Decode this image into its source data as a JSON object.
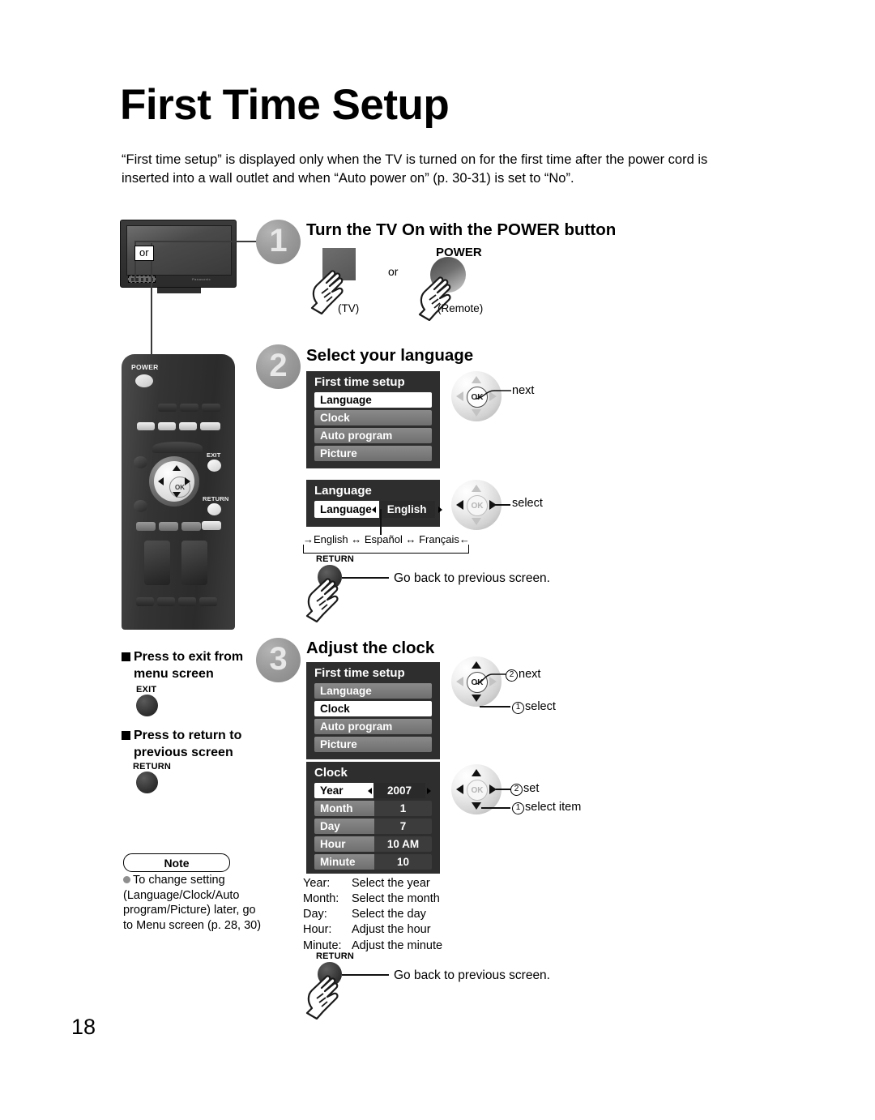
{
  "page": {
    "title": "First Time Setup",
    "intro": "“First time setup” is displayed only when the TV is turned on for the first time after the power cord is inserted into a wall outlet and when “Auto power on” (p. 30-31) is set to “No”.",
    "number": "18"
  },
  "step1": {
    "number": "1",
    "heading": "Turn the TV On with the POWER button",
    "tv_or_label": "or",
    "or_text": "or",
    "power_label": "POWER",
    "tv_caption": "(TV)",
    "remote_caption": "(Remote)"
  },
  "step2": {
    "number": "2",
    "heading": "Select your language",
    "menu": {
      "title": "First time setup",
      "items": [
        {
          "label": "Language",
          "selected": true
        },
        {
          "label": "Clock",
          "selected": false
        },
        {
          "label": "Auto program",
          "selected": false
        },
        {
          "label": "Picture",
          "selected": false
        }
      ]
    },
    "nav_next_label": "next",
    "language_menu": {
      "title": "Language",
      "row_label": "Language",
      "row_value": "English"
    },
    "nav_select_label": "select",
    "language_cycle": "→English ↔ Español ↔ Français←",
    "return_button_label": "RETURN",
    "return_text": "Go back to previous screen."
  },
  "step3": {
    "number": "3",
    "heading": "Adjust the clock",
    "menu": {
      "title": "First time setup",
      "items": [
        {
          "label": "Language",
          "selected": false
        },
        {
          "label": "Clock",
          "selected": true
        },
        {
          "label": "Auto program",
          "selected": false
        },
        {
          "label": "Picture",
          "selected": false
        }
      ]
    },
    "nav_next_label": "next",
    "nav_next_num": "②",
    "nav_select_label": "select",
    "nav_select_num": "①",
    "clock_menu": {
      "title": "Clock",
      "rows": [
        {
          "label": "Year",
          "value": "2007",
          "selected": true
        },
        {
          "label": "Month",
          "value": "1",
          "selected": false
        },
        {
          "label": "Day",
          "value": "7",
          "selected": false
        },
        {
          "label": "Hour",
          "value": "10 AM",
          "selected": false
        },
        {
          "label": "Minute",
          "value": "10",
          "selected": false
        }
      ]
    },
    "nav_set_label": "set",
    "nav_set_num": "②",
    "nav_selectitem_label": "select item",
    "nav_selectitem_num": "①",
    "legend": [
      {
        "key": "Year:",
        "desc": "Select the year"
      },
      {
        "key": "Month:",
        "desc": "Select the month"
      },
      {
        "key": "Day:",
        "desc": "Select the day"
      },
      {
        "key": "Hour:",
        "desc": "Adjust the hour"
      },
      {
        "key": "Minute:",
        "desc": "Adjust the minute"
      }
    ],
    "return_button_label": "RETURN",
    "return_text": "Go back to previous screen."
  },
  "sidebar": {
    "exit_heading_line1": "Press to exit from",
    "exit_heading_line2": "menu screen",
    "exit_button_label": "EXIT",
    "return_heading_line1": "Press to return to",
    "return_heading_line2": "previous screen",
    "return_button_label": "RETURN"
  },
  "note": {
    "badge": "Note",
    "text": "To change setting (Language/Clock/Auto program/Picture) later, go to Menu screen (p. 28, 30)"
  },
  "remote": {
    "power_label": "POWER",
    "exit_label": "EXIT",
    "return_label": "RETURN",
    "ok_label": "OK"
  },
  "colors": {
    "osd_bg": "#2e2e2e",
    "osd_row": "#7b7b7b",
    "highlight": "#ffffff",
    "step_circle": "#9b9b9b"
  }
}
